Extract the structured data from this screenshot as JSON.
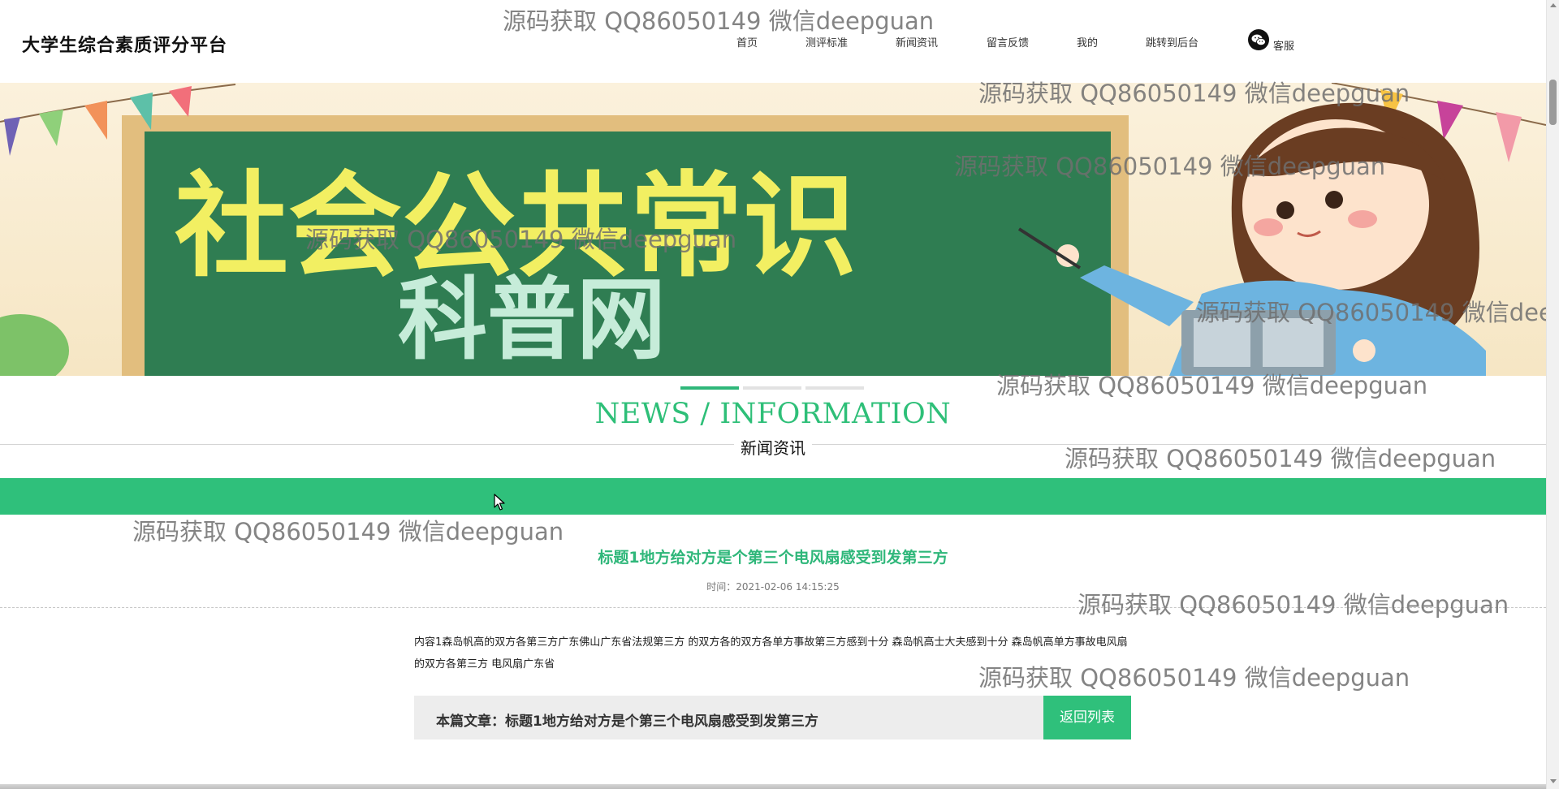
{
  "header": {
    "site_title": "大学生综合素质评分平台",
    "nav": [
      {
        "label": "首页"
      },
      {
        "label": "测评标准"
      },
      {
        "label": "新闻资讯"
      },
      {
        "label": "留言反馈"
      },
      {
        "label": "我的"
      },
      {
        "label": "跳转到后台"
      }
    ],
    "service_label": "客服",
    "service_icon": "wechat-icon"
  },
  "banner": {
    "title_line1": "社会公共常识",
    "title_line2": "科普网",
    "slides_count": 3,
    "active_slide": 1
  },
  "section": {
    "title_en": "NEWS / INFORMATION",
    "title_cn": "新闻资讯"
  },
  "article": {
    "title": "标题1地方给对方是个第三个电风扇感受到发第三方",
    "time": "时间：2021-02-06 14:15:25",
    "content": "内容1森岛帆高的双方各第三方广东佛山广东省法规第三方 的双方各的双方各单方事故第三方感到十分 森岛帆高士大夫感到十分 森岛帆高单方事故电风扇 的双方各第三方 电风扇广东省",
    "current_label": "本篇文章：标题1地方给对方是个第三个电风扇感受到发第三方",
    "back_button": "返回列表"
  },
  "watermark": "源码获取 QQ86050149 微信deepguan",
  "colors": {
    "accent": "#2fc07b",
    "banner_board": "#2d7a52",
    "banner_text": "#f2ef62"
  }
}
